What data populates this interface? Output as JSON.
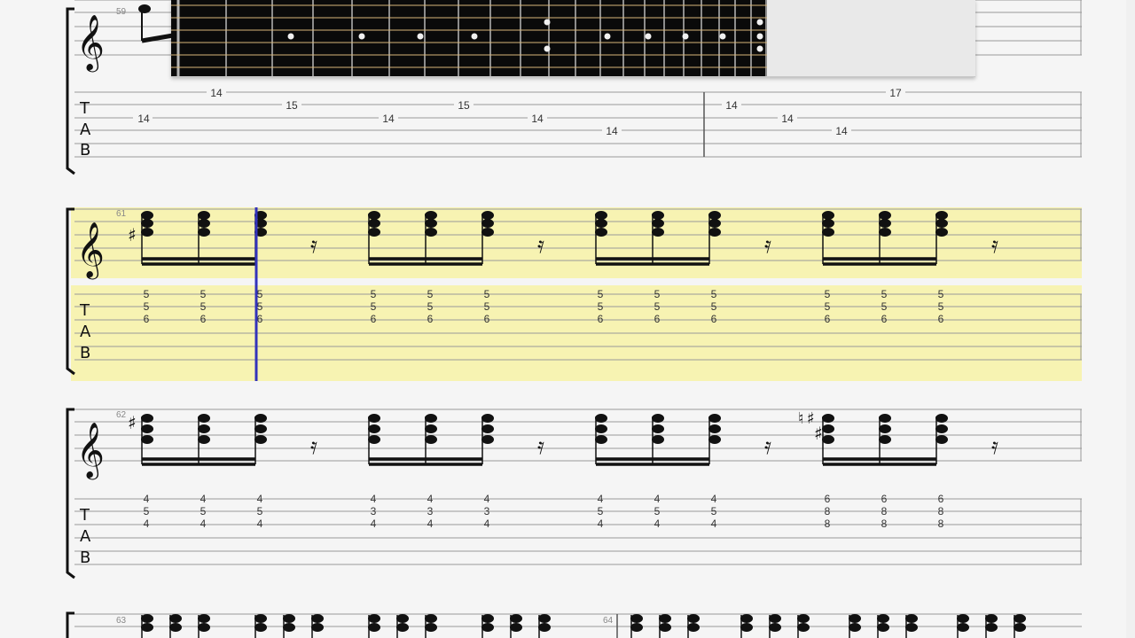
{
  "colors": {
    "highlight": "#f7f3b2",
    "cursor": "#3333bb",
    "fretboard_bg": "#0a0a0a",
    "fret_line": "#b7b7b7",
    "string_line": "#d8b77a",
    "inlay": "#f0f0f0"
  },
  "icons": {
    "treble_clef": "treble-clef-icon",
    "sharp": "sharp-icon",
    "natural": "natural-icon",
    "rest": "sixteenth-rest-icon"
  },
  "tab_clef": {
    "t": "T",
    "a": "A",
    "b": "B"
  },
  "glyphs": {
    "treble_clef": "𝄞",
    "sharp": "♯",
    "natural": "♮",
    "rest": "𝄿"
  },
  "measures": [
    {
      "number": "59",
      "notes": [
        {
          "string": 2,
          "fret": "14"
        },
        {
          "string": 1,
          "fret": "14"
        },
        {
          "string": 2,
          "fret": "15"
        },
        {
          "string": 3,
          "fret": "14"
        },
        {
          "string": 2,
          "fret": "15"
        },
        {
          "string": 3,
          "fret": "14"
        },
        {
          "string": 4,
          "fret": "14"
        }
      ]
    },
    {
      "number": "",
      "notes": [
        {
          "string": 2,
          "fret": "14"
        },
        {
          "string": 3,
          "fret": "14"
        },
        {
          "string": 4,
          "fret": "14"
        },
        {
          "string": 1,
          "fret": "17"
        }
      ]
    },
    {
      "number": "61",
      "groups": [
        {
          "chords": [
            [
              "5",
              "5",
              "6"
            ],
            [
              "5",
              "5",
              "6"
            ],
            [
              "5",
              "5",
              "6"
            ]
          ]
        },
        {
          "chords": [
            [
              "5",
              "5",
              "6"
            ],
            [
              "5",
              "5",
              "6"
            ],
            [
              "5",
              "5",
              "6"
            ]
          ]
        },
        {
          "chords": [
            [
              "5",
              "5",
              "6"
            ],
            [
              "5",
              "5",
              "6"
            ],
            [
              "5",
              "5",
              "6"
            ]
          ]
        },
        {
          "chords": [
            [
              "5",
              "5",
              "6"
            ],
            [
              "5",
              "5",
              "6"
            ],
            [
              "5",
              "5",
              "6"
            ]
          ]
        }
      ]
    },
    {
      "number": "62",
      "groups": [
        {
          "chords": [
            [
              "4",
              "5",
              "4"
            ],
            [
              "4",
              "5",
              "4"
            ],
            [
              "4",
              "5",
              "4"
            ]
          ]
        },
        {
          "chords": [
            [
              "4",
              "3",
              "4"
            ],
            [
              "4",
              "3",
              "4"
            ],
            [
              "4",
              "3",
              "4"
            ]
          ]
        },
        {
          "chords": [
            [
              "4",
              "5",
              "4"
            ],
            [
              "4",
              "5",
              "4"
            ],
            [
              "4",
              "5",
              "4"
            ]
          ]
        },
        {
          "chords": [
            [
              "6",
              "8",
              "8"
            ],
            [
              "6",
              "8",
              "8"
            ],
            [
              "6",
              "8",
              "8"
            ]
          ]
        }
      ]
    },
    {
      "number": "63"
    },
    {
      "number": "64"
    }
  ]
}
